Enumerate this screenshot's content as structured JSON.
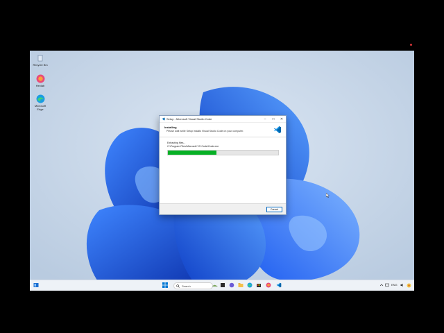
{
  "desktop": {
    "icons": [
      {
        "label": "Recycle Bin",
        "icon": "recycle-bin-icon"
      },
      {
        "label": "Hexlab",
        "icon": "hexlab-icon"
      },
      {
        "label": "Microsoft\nEdge",
        "icon": "edge-icon"
      }
    ]
  },
  "dialog": {
    "title": "Setup - Microsoft Visual Studio Code",
    "minimize": "–",
    "maximize": "□",
    "close": "✕",
    "heading": "Installing",
    "subheading": "Please wait while Setup installs Visual Studio Code on your computer.",
    "status": "Extracting files...",
    "path": "C:\\Program Files\\Microsoft VS Code\\Code.exe",
    "progress": 0.44,
    "cancel_label": "Cancel"
  },
  "taskbar": {
    "search_placeholder": "Search",
    "tray_lang": "ENG",
    "colors": {
      "accent": "#0067c0",
      "progress": "#06b025"
    }
  }
}
